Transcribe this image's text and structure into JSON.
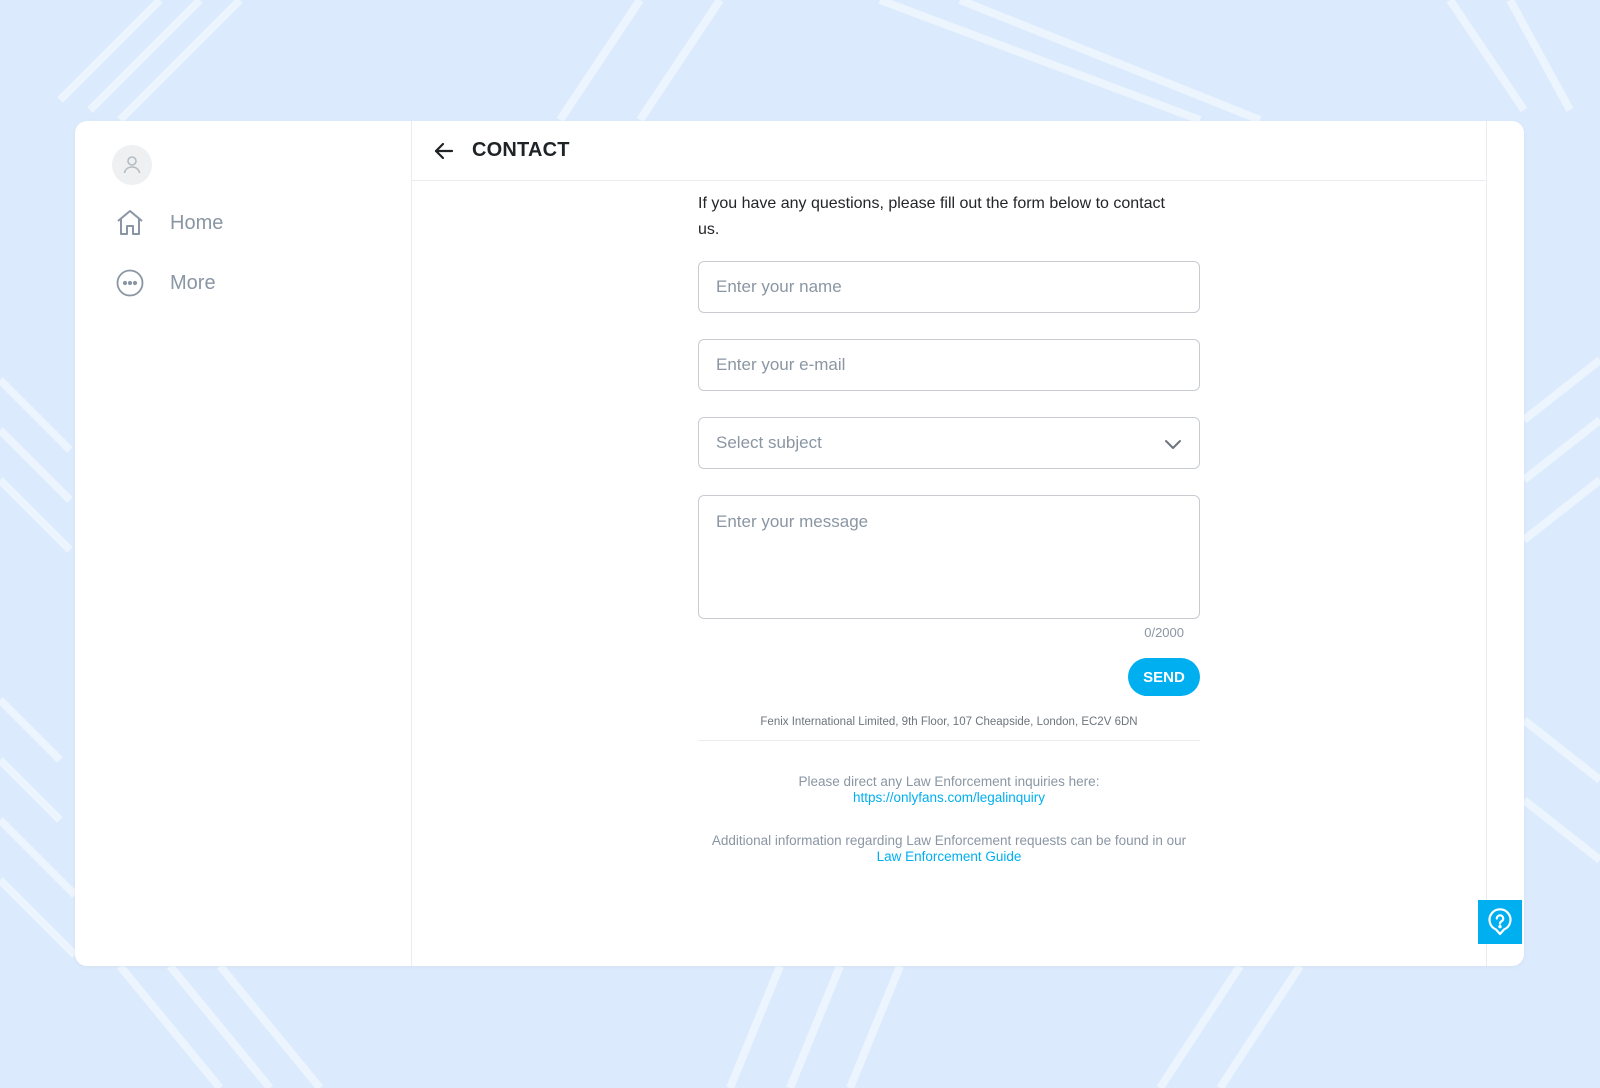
{
  "sidebar": {
    "items": [
      {
        "label": "Home",
        "icon": "home-icon"
      },
      {
        "label": "More",
        "icon": "more-icon"
      }
    ]
  },
  "header": {
    "title": "CONTACT"
  },
  "form": {
    "intro": "If you have any questions, please fill out the form below to contact us.",
    "name_placeholder": "Enter your name",
    "email_placeholder": "Enter your e-mail",
    "subject_value": "Select subject",
    "message_placeholder": "Enter your message",
    "counter": "0/2000",
    "send_label": "SEND"
  },
  "footer": {
    "address": "Fenix International Limited, 9th Floor, 107 Cheapside, London, EC2V 6DN",
    "law_text": "Please direct any Law Enforcement inquiries here:",
    "law_link": "https://onlyfans.com/legalinquiry",
    "guide_text": "Additional information regarding Law Enforcement requests can be found in our",
    "guide_link": "Law Enforcement Guide"
  },
  "colors": {
    "accent": "#00aff0",
    "muted": "#8a96a3",
    "background": "#dbeafc"
  }
}
